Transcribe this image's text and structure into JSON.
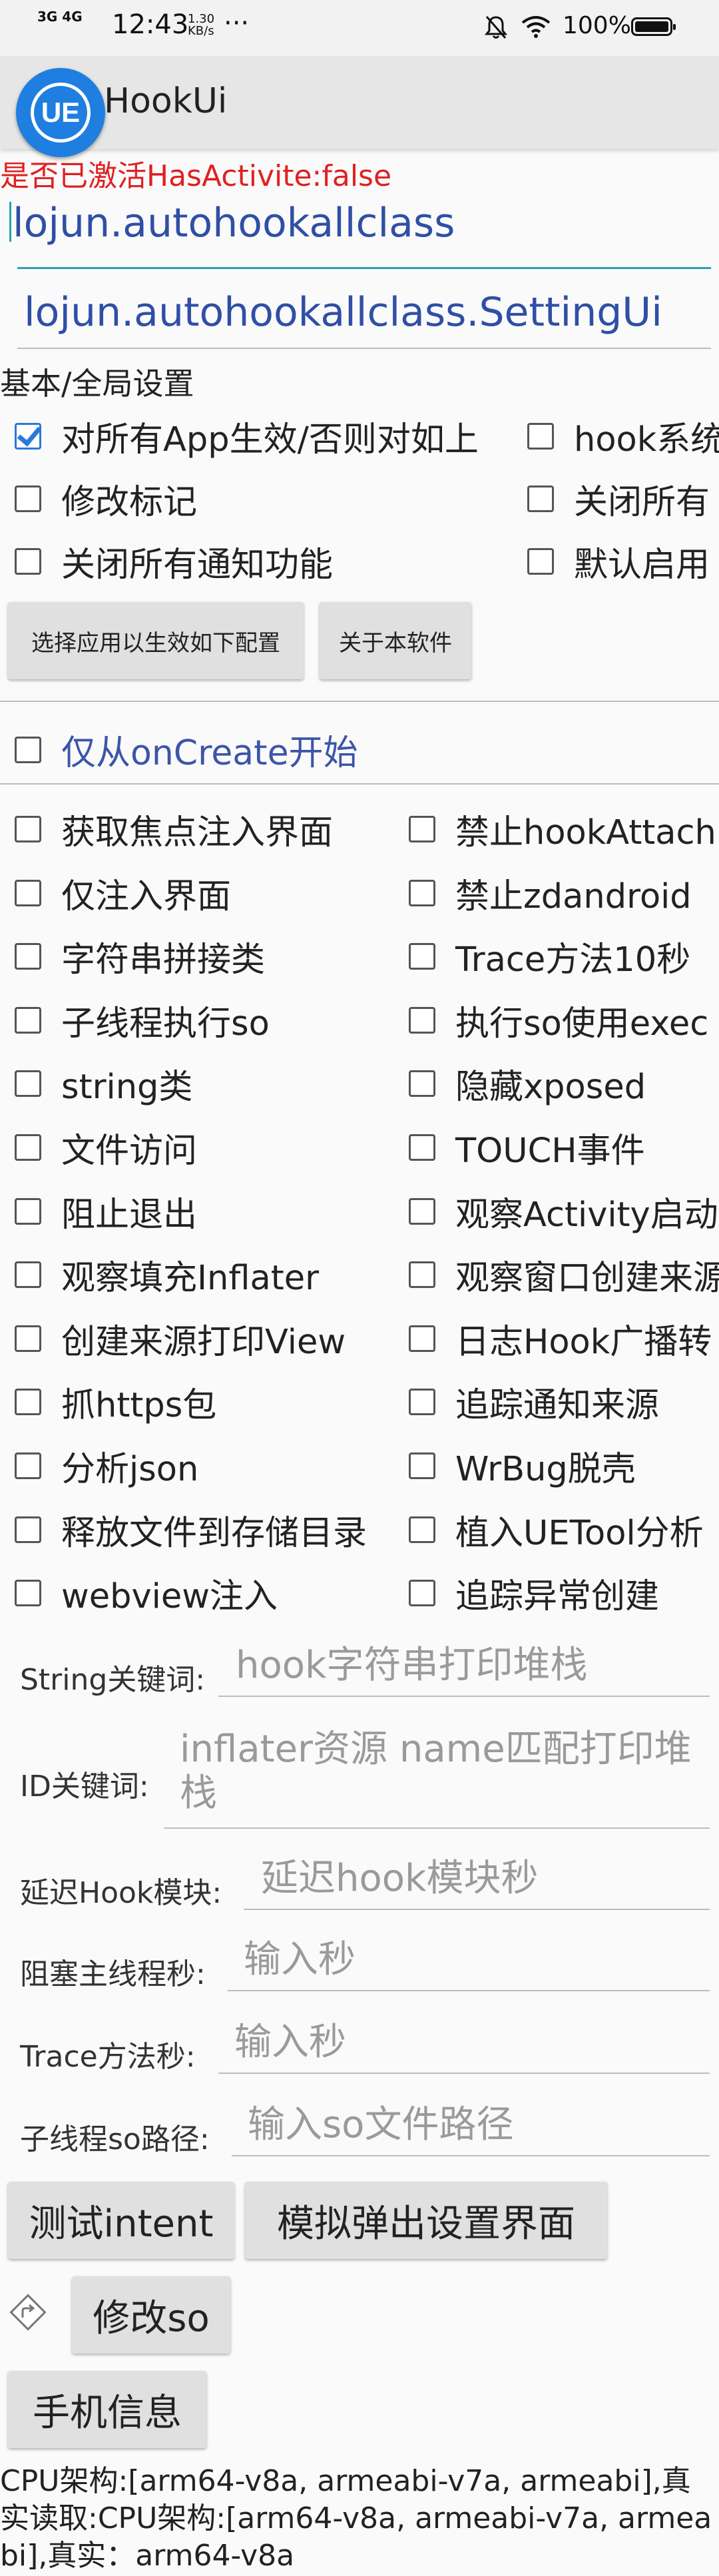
{
  "status_bar": {
    "network": "3G 4G",
    "time": "12:43",
    "speed": "1.30 KB/s",
    "more": "···",
    "battery_text": "100%"
  },
  "app_bar": {
    "logo_text": "UE",
    "title": "HookUi"
  },
  "activation_status": "是否已激活HasActivite:false",
  "package_field": {
    "value": "lojun.autohookallclass"
  },
  "class_field": {
    "value": "lojun.autohookallclass.SettingUi"
  },
  "global_settings": {
    "label": "基本/全局设置",
    "options": [
      {
        "label": "对所有App生效/否则对如上",
        "checked": true
      },
      {
        "label": "hook系统",
        "checked": false
      },
      {
        "label": "修改标记",
        "checked": false
      },
      {
        "label": "关闭所有",
        "checked": false
      },
      {
        "label": "关闭所有通知功能",
        "checked": false
      },
      {
        "label": "默认启用",
        "checked": false
      }
    ]
  },
  "buttons_top": {
    "select_app": "选择应用以生效如下配置",
    "about": "关于本软件"
  },
  "oncreate_option": {
    "label": "仅从onCreate开始",
    "checked": false
  },
  "feature_options": {
    "left": [
      "获取焦点注入界面",
      "仅注入界面",
      "字符串拼接类",
      "子线程执行so",
      "string类",
      "文件访问",
      "阻止退出",
      "观察填充Inflater",
      "创建来源打印View",
      "抓https包",
      "分析json",
      "释放文件到存储目录",
      "webview注入"
    ],
    "right": [
      "禁止hookAttach",
      "禁止zdandroid",
      "Trace方法10秒",
      "执行so使用exec",
      "隐藏xposed",
      "TOUCH事件",
      "观察Activity启动",
      "观察窗口创建来源",
      "日志Hook广播转",
      "追踪通知来源",
      "WrBug脱壳",
      "植入UETool分析",
      "追踪异常创建"
    ]
  },
  "fields": {
    "string_keyword": {
      "label": "String关键词:",
      "placeholder": "hook字符串打印堆栈"
    },
    "id_keyword": {
      "label": "ID关键词:",
      "placeholder": "inflater资源 name匹配打印堆栈"
    },
    "delay_hook": {
      "label": "延迟Hook模块:",
      "placeholder": "延迟hook模块秒"
    },
    "block_main": {
      "label": "阻塞主线程秒:",
      "placeholder": "输入秒"
    },
    "trace_method": {
      "label": "Trace方法秒:",
      "placeholder": "输入秒"
    },
    "so_path": {
      "label": "子线程so路径:",
      "placeholder": "输入so文件路径"
    }
  },
  "buttons_bottom": {
    "test_intent": "测试intent",
    "simulate_settings": "模拟弹出设置界面",
    "modify_so": "修改so",
    "phone_info": "手机信息"
  },
  "device_info": "CPU架构:[arm64-v8a, armeabi-v7a, armeabi],真实读取:CPU架构:[arm64-v8a, armeabi-v7a, armeabi],真实：arm64-v8a"
}
